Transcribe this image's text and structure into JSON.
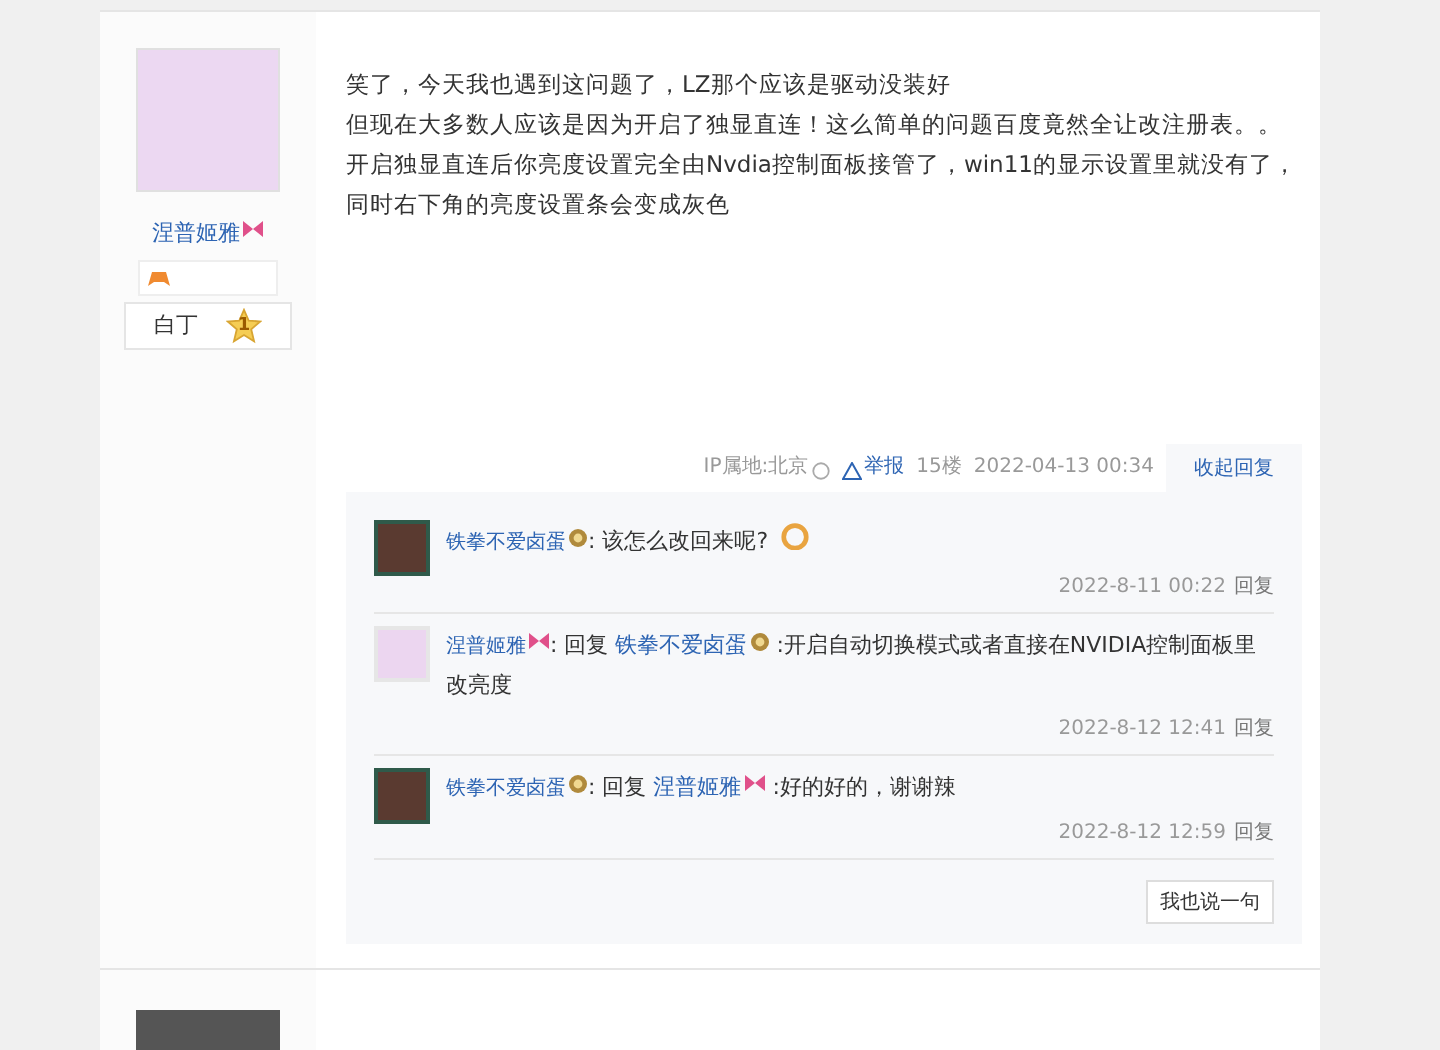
{
  "post": {
    "author": {
      "name": "涅普姬雅",
      "badge": {
        "kind": "bow"
      }
    },
    "level": {
      "title": "白丁",
      "number": "1"
    },
    "content": [
      "笑了，今天我也遇到这问题了，LZ那个应该是驱动没装好",
      "但现在大多数人应该是因为开启了独显直连！这么简单的问题百度竟然全让改注册表。。",
      "开启独显直连后你亮度设置完全由Nvdia控制面板接管了，win11的显示设置里就没有了，同时右下角的亮度设置条会变成灰色"
    ],
    "meta": {
      "ip": "IP属地:北京",
      "report": "举报",
      "floor": "15楼",
      "time": "2022-04-13 00:34",
      "collapse": "收起回复"
    },
    "replies": [
      {
        "avatar": {
          "kind": "dark"
        },
        "author": "铁拳不爱卤蛋",
        "author_badge": {
          "kind": "medal"
        },
        "text": ": 该怎么改回来呢?",
        "emoticon": true,
        "time": "2022-8-11 00:22",
        "reply": "回复"
      },
      {
        "avatar": {
          "kind": "pink"
        },
        "author": "涅普姬雅",
        "author_badge": {
          "kind": "bow"
        },
        "prefix": ": 回复",
        "target": "铁拳不爱卤蛋",
        "target_badge": {
          "kind": "medal"
        },
        "text": " :开启自动切换模式或者直接在NVIDIA控制面板里改亮度",
        "emoticon": false,
        "time": "2022-8-12 12:41",
        "reply": "回复"
      },
      {
        "avatar": {
          "kind": "dark"
        },
        "author": "铁拳不爱卤蛋",
        "author_badge": {
          "kind": "medal"
        },
        "prefix": ": 回复",
        "target": "涅普姬雅",
        "target_badge": {
          "kind": "bow"
        },
        "text": " :好的好的，谢谢辣",
        "emoticon": false,
        "time": "2022-8-12 12:59",
        "reply": "回复"
      }
    ],
    "reply_button": "我也说一句"
  }
}
